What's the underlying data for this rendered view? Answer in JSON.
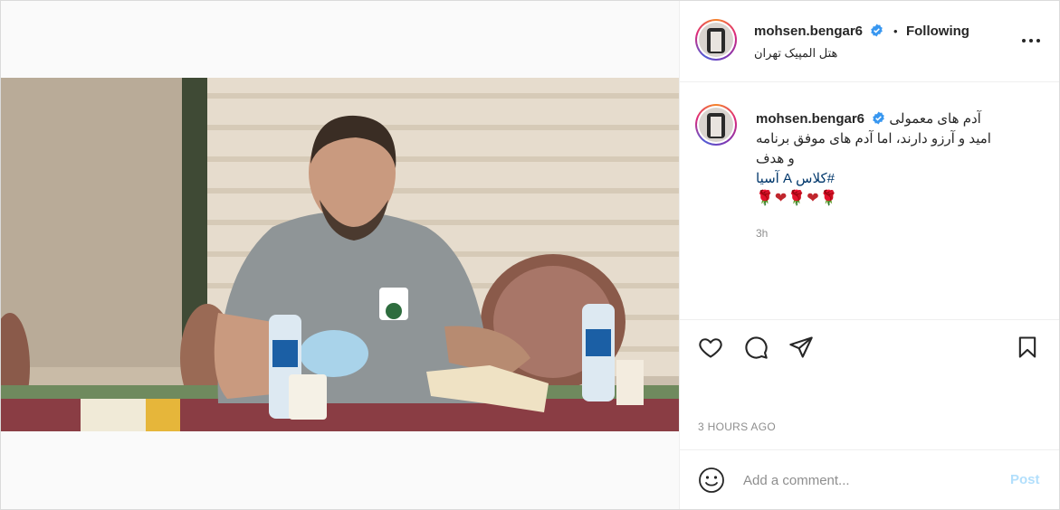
{
  "post": {
    "photo_alt": "",
    "author": {
      "username": "mohsen.bengar6",
      "verified": true,
      "follow_status": "Following",
      "location": "هتل المپیک تهران"
    },
    "caption": {
      "username": "mohsen.bengar6",
      "line1": "آدم های معمولی",
      "line2": "امید و آرزو دارند، اما آدم های موفق برنامه",
      "line3": "و هدف",
      "hashtag": "#کلاس A آسیا",
      "emojis": "🌹❤🌹❤🌹",
      "time": "3h"
    },
    "timestamp": "3 HOURS AGO",
    "comment_box": {
      "placeholder": "Add a comment...",
      "post_label": "Post"
    },
    "icons": {
      "more": "more-options-icon",
      "like": "heart-icon",
      "comment": "comment-icon",
      "share": "paper-plane-icon",
      "save": "bookmark-icon",
      "emoji": "smile-icon"
    },
    "colors": {
      "verified": "#3897f0",
      "link": "#00376b",
      "post_disabled": "#b2dffc",
      "muted": "#8e8e8e"
    }
  }
}
